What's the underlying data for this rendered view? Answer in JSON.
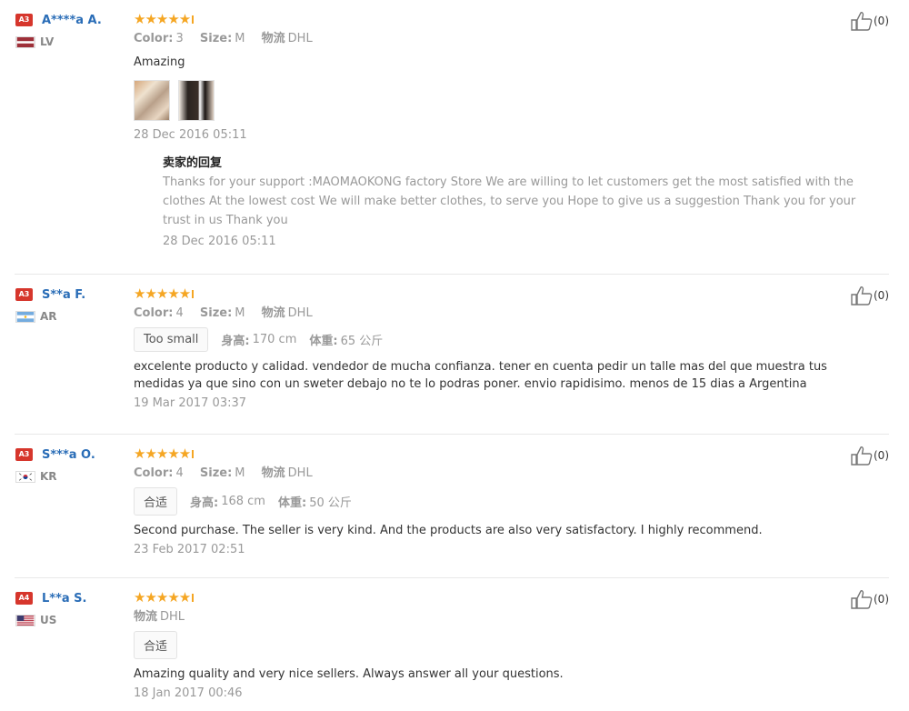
{
  "reviews": [
    {
      "level": "A3",
      "name": "A****a A.",
      "country": "LV",
      "rating": 5,
      "color_label": "Color:",
      "color": "3",
      "size_label": "Size:",
      "size": "M",
      "logistics_label": "物流",
      "logistics": "DHL",
      "text": "Amazing",
      "photos": [
        "photo-1",
        "photo-2"
      ],
      "date": "28 Dec 2016 05:11",
      "reply": {
        "title": "卖家的回复",
        "text": "Thanks for your support :MAOMAOKONG factory Store We are willing to let customers get the most satisfied with the clothes At the lowest cost We will make better clothes, to serve you Hope to give us a suggestion Thank you for your trust in us Thank you",
        "date": "28 Dec 2016 05:11"
      },
      "likes": "(0)"
    },
    {
      "level": "A3",
      "name": "S**a F.",
      "country": "AR",
      "rating": 5,
      "color_label": "Color:",
      "color": "4",
      "size_label": "Size:",
      "size": "M",
      "logistics_label": "物流",
      "logistics": "DHL",
      "fit": "Too small",
      "height_label": "身高:",
      "height": "170 cm",
      "weight_label": "体重:",
      "weight": "65 公斤",
      "text": "excelente producto y calidad. vendedor de mucha confianza. tener en cuenta pedir un talle mas del que muestra tus medidas ya que sino con un sweter debajo no te lo podras poner. envio rapidisimo. menos de 15 dias a Argentina",
      "date": "19 Mar 2017 03:37",
      "likes": "(0)"
    },
    {
      "level": "A3",
      "name": "S***a O.",
      "country": "KR",
      "rating": 5,
      "color_label": "Color:",
      "color": "4",
      "size_label": "Size:",
      "size": "M",
      "logistics_label": "物流",
      "logistics": "DHL",
      "fit": "合适",
      "height_label": "身高:",
      "height": "168 cm",
      "weight_label": "体重:",
      "weight": "50 公斤",
      "text": "Second purchase. The seller is very kind. And the products are also very satisfactory. I highly recommend.",
      "date": "23 Feb 2017 02:51",
      "likes": "(0)"
    },
    {
      "level": "A4",
      "name": "L**a S.",
      "country": "US",
      "rating": 5,
      "logistics_label": "物流",
      "logistics": "DHL",
      "fit": "合适",
      "text": "Amazing quality and very nice sellers. Always answer all your questions.",
      "date": "18 Jan 2017 00:46",
      "likes": "(0)"
    }
  ],
  "icons": {
    "star": "star-icon",
    "like": "thumbs-up-icon"
  },
  "colors": {
    "star": "#f5a623",
    "name": "#2a6db7",
    "level_badge": "#d6362c"
  }
}
